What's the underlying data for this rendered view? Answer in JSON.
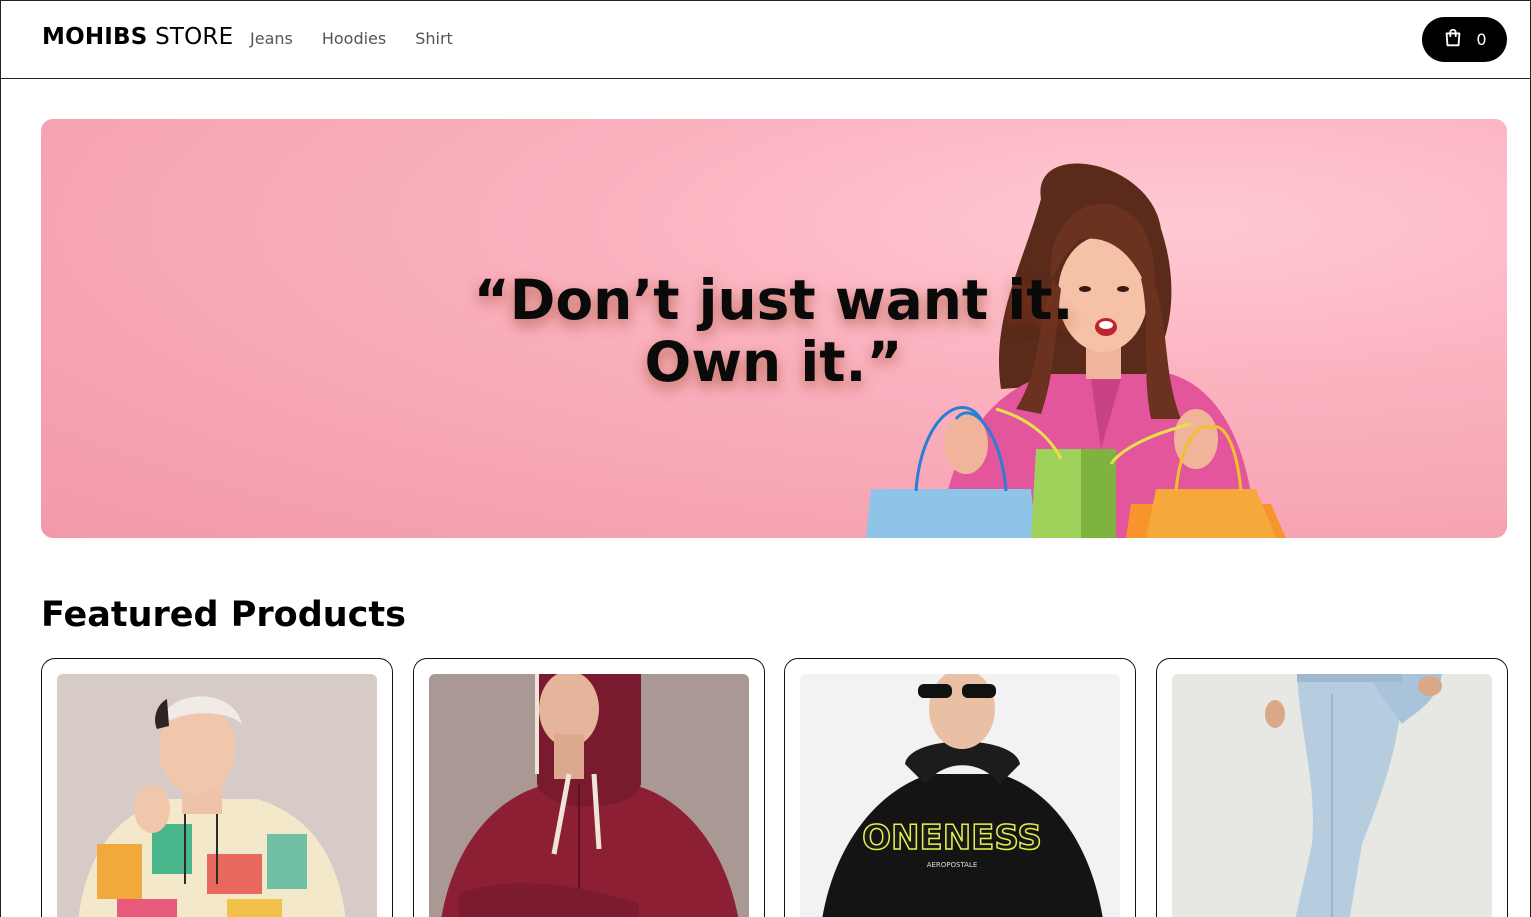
{
  "header": {
    "brand_bold": "MOHIBS",
    "brand_regular": "STORE",
    "nav": [
      "Jeans",
      "Hoodies",
      "Shirt"
    ],
    "cart_count": "0",
    "cart_icon": "shopping-bag-icon"
  },
  "hero": {
    "quote": "“Don’t just want it. Own it.”"
  },
  "featured": {
    "title": "Featured Products",
    "products": [
      {
        "image": "colorful-print-hoodie"
      },
      {
        "image": "maroon-zip-hoodie"
      },
      {
        "image": "black-oneness-hoodie"
      },
      {
        "image": "light-wash-jeans"
      }
    ]
  },
  "colors": {
    "hero_pink": "#f6a2b1",
    "accent_black": "#000000"
  }
}
